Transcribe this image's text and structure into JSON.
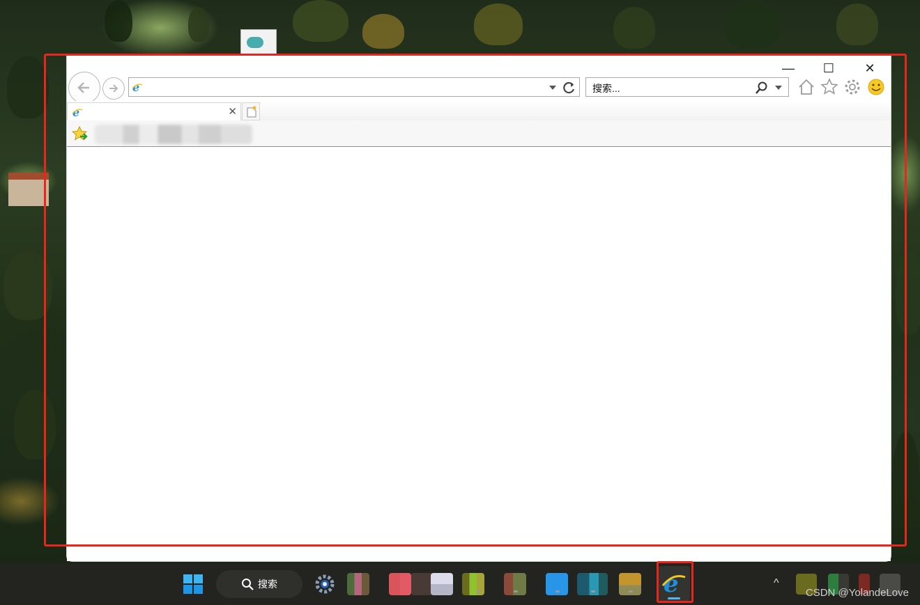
{
  "desktop": {
    "shortcut_icon": "network-document-icon"
  },
  "browser": {
    "caption_buttons": {
      "minimize": "—",
      "maximize": "☐",
      "close": "✕"
    },
    "nav": {
      "back_icon": "back-arrow-icon",
      "forward_icon": "forward-arrow-icon",
      "address_value": "",
      "address_icon": "ie-logo-icon",
      "dropdown_icon": "chevron-down-icon",
      "refresh_icon": "refresh-icon"
    },
    "search": {
      "placeholder": "搜索...",
      "search_icon": "magnifier-icon",
      "dropdown_icon": "chevron-down-icon"
    },
    "toolbar_icons": [
      "home-icon",
      "favorites-star-icon",
      "settings-gear-icon",
      "feedback-smiley-icon"
    ],
    "tab": {
      "title": "",
      "close_label": "✕"
    },
    "favorites_bar": {
      "add_icon": "add-to-favorites-icon"
    }
  },
  "taskbar": {
    "search_label": "搜索",
    "watermark": "CSDN @YolandeLove",
    "tray_chevron": "^",
    "colors": {
      "highlight": "#e8261d",
      "ie_blue": "#1e8fdc",
      "ie_yellow": "#f3c623"
    }
  }
}
